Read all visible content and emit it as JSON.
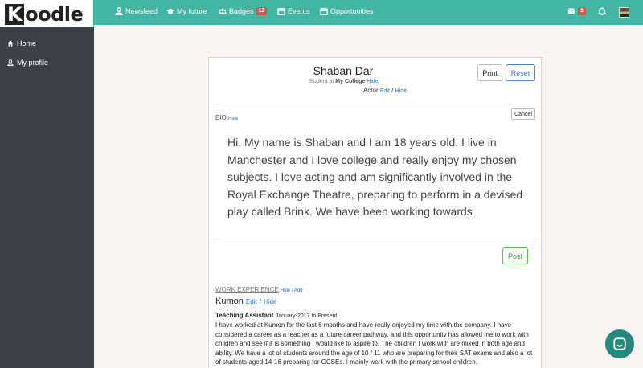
{
  "app": {
    "logo_initial": "K",
    "logo_rest": "oodle"
  },
  "sidebar": {
    "items": [
      {
        "label": "Home",
        "icon": "home-icon"
      },
      {
        "label": "My profile",
        "icon": "user-icon"
      }
    ]
  },
  "topnav": {
    "items": [
      {
        "label": "Newsfeed",
        "icon": "user-icon"
      },
      {
        "label": "My future",
        "icon": "graduation-cap-icon"
      },
      {
        "label": "Badges",
        "icon": "users-icon",
        "badge": "12"
      },
      {
        "label": "Events",
        "icon": "calendar-icon"
      },
      {
        "label": "Opportunities",
        "icon": "calendar-icon"
      }
    ],
    "messages_badge": "1"
  },
  "colors": {
    "topbar": "#40b6a3",
    "sidebar": "#3c4147",
    "badge": "#d9534f",
    "link": "#2a70c8",
    "chat": "#238a7c"
  },
  "profile": {
    "name": "Shaban Dar",
    "subtitle_prefix": "Student at",
    "school": "My College",
    "school_hide": "Hide",
    "role": "Actor",
    "role_edit": "Edit",
    "role_sep": "/",
    "role_hide": "Hide",
    "print_label": "Print",
    "reset_label": "Reset"
  },
  "bio": {
    "heading": "BIO",
    "hide": "Hide",
    "cancel_label": "Cancel",
    "text": "Hi. My name is Shaban and I am 18 years old. I live in Manchester and I love college and really enjoy my chosen subjects. I love acting and am significantly involved in the Royal Exchange Theatre, preparing to perform in a devised play called Brink. We have been working towards",
    "post_label": "Post"
  },
  "work": {
    "heading": "WORK EXPERIENCE",
    "hide_add": "Hide / Add",
    "company": "Kumon",
    "edit": "Edit",
    "sep": "/",
    "hide": "Hide",
    "job_title": "Teaching Assistant",
    "dates": "January-2017 to Present",
    "description": "I have worked at Kumon for the last 6 months and have really enjoyed my time with the company. I have considered a career as a teacher as a future career pathway, and this opportunity has allowed me to work with children and see if it is something I would like to aspire to. The children I work with are mixed in both age and ability. We have a lot of students around the age of 10 / 11 who are preparing for their SAT exams and also a lot of students aged 14-16 preparing for GCSEs. I mainly work with the primary school children."
  }
}
